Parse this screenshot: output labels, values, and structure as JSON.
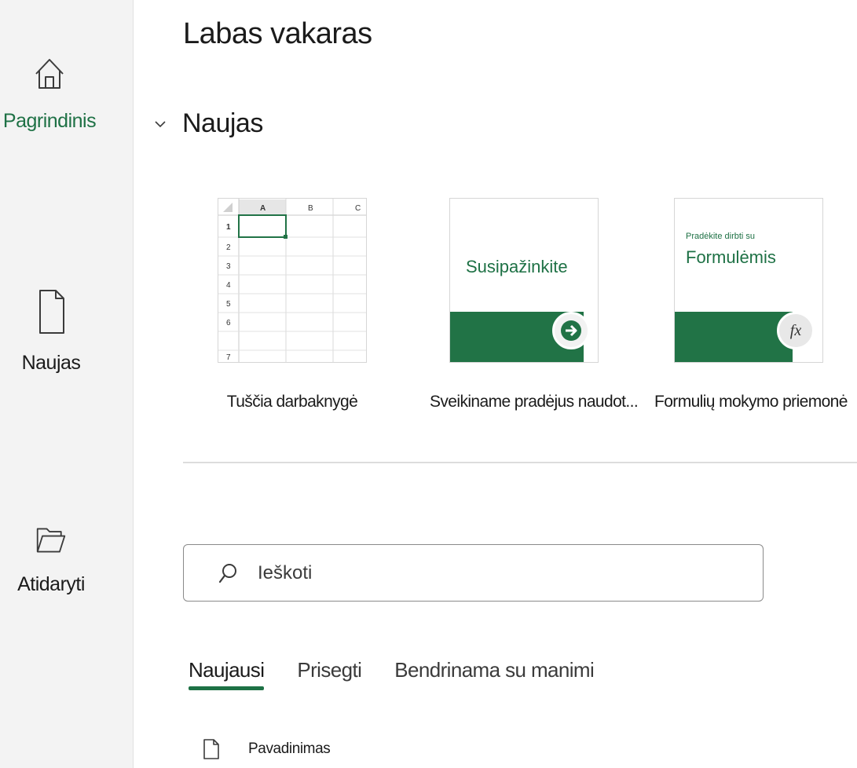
{
  "sidebar": {
    "items": [
      {
        "label": "Pagrindinis",
        "icon": "home-icon",
        "active": true
      },
      {
        "label": "Naujas",
        "icon": "new-file-icon",
        "active": false
      },
      {
        "label": "Atidaryti",
        "icon": "open-folder-icon",
        "active": false
      }
    ]
  },
  "main": {
    "greeting": "Labas vakaras",
    "new_section": {
      "title": "Naujas",
      "templates": [
        {
          "label": "Tuščia darbaknygė",
          "thumb": {
            "columns": [
              "A",
              "B",
              "C"
            ],
            "rows": [
              "1",
              "2",
              "3",
              "4",
              "5",
              "6",
              "7"
            ]
          }
        },
        {
          "label": "Sveikiname pradėjus naudot...",
          "thumb": {
            "text": "Susipažinkite",
            "icon": "arrow-right-icon"
          }
        },
        {
          "label": "Formulių mokymo priemonė",
          "thumb": {
            "small_text": "Pradėkite dirbti su",
            "text": "Formulėmis",
            "icon": "fx-icon",
            "icon_text": "fx"
          }
        }
      ]
    },
    "search": {
      "placeholder": "Ieškoti",
      "value": ""
    },
    "tabs": [
      {
        "label": "Naujausi",
        "active": true
      },
      {
        "label": "Prisegti",
        "active": false
      },
      {
        "label": "Bendrinama su manimi",
        "active": false
      }
    ],
    "file_list": {
      "name_column": "Pavadinimas"
    }
  },
  "colors": {
    "accent": "#1e7145",
    "excel_green": "#217346",
    "sidebar_bg": "#f3f3f3"
  }
}
